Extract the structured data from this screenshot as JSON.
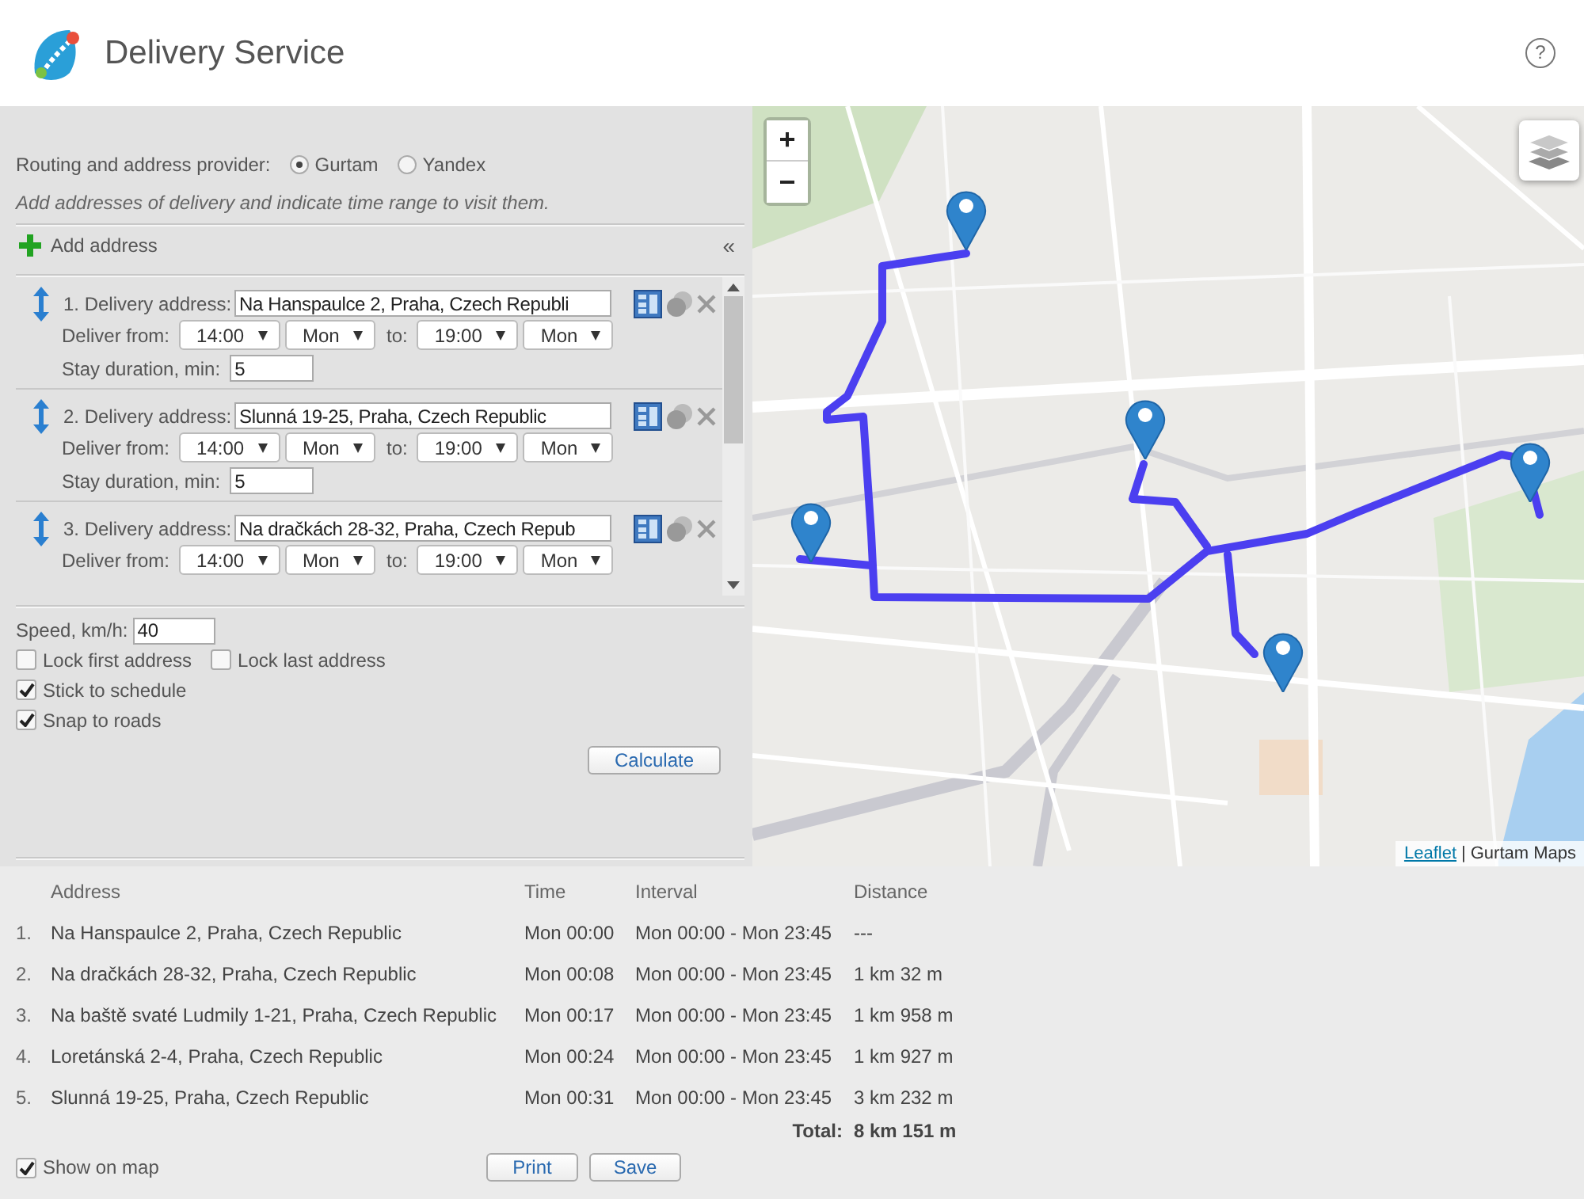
{
  "header": {
    "title": "Delivery Service",
    "help": "?"
  },
  "provider": {
    "label": "Routing and address provider:",
    "options": [
      {
        "label": "Gurtam",
        "selected": true
      },
      {
        "label": "Yandex",
        "selected": false
      }
    ]
  },
  "hint": "Add addresses of delivery and indicate time range to visit them.",
  "add_address": {
    "label": "Add address",
    "collapse": "«"
  },
  "addresses": [
    {
      "label": "1. Delivery address:",
      "address": "Na Hanspaulce 2, Praha, Czech Republi",
      "from_label": "Deliver from:",
      "from_time": "14:00",
      "from_day": "Mon",
      "to_label": "to:",
      "to_time": "19:00",
      "to_day": "Mon",
      "stay_label": "Stay duration, min:",
      "stay": "5"
    },
    {
      "label": "2. Delivery address:",
      "address": "Slunná 19-25, Praha, Czech Republic",
      "from_label": "Deliver from:",
      "from_time": "14:00",
      "from_day": "Mon",
      "to_label": "to:",
      "to_time": "19:00",
      "to_day": "Mon",
      "stay_label": "Stay duration, min:",
      "stay": "5"
    },
    {
      "label": "3. Delivery address:",
      "address": "Na dračkách 28-32, Praha, Czech Repub",
      "from_label": "Deliver from:",
      "from_time": "14:00",
      "from_day": "Mon",
      "to_label": "to:",
      "to_time": "19:00",
      "to_day": "Mon"
    }
  ],
  "speed": {
    "label": "Speed, km/h:",
    "value": "40"
  },
  "option_rows": [
    [
      {
        "label": "Lock first address",
        "checked": false
      },
      {
        "label": "Lock last address",
        "checked": false
      }
    ],
    [
      {
        "label": "Stick to schedule",
        "checked": true
      }
    ],
    [
      {
        "label": "Snap to roads",
        "checked": true
      }
    ]
  ],
  "calculate": "Calculate",
  "map": {
    "zoom_in": "+",
    "zoom_out": "−",
    "attribution_link": "Leaflet",
    "attribution_separator": "|",
    "attribution_text": "Gurtam Maps"
  },
  "results": {
    "columns": [
      "Address",
      "Time",
      "Interval",
      "Distance"
    ],
    "rows": [
      {
        "index": "1.",
        "address": "Na Hanspaulce 2, Praha, Czech Republic",
        "time": "Mon 00:00",
        "interval": "Mon 00:00 - Mon 23:45",
        "distance": "---"
      },
      {
        "index": "2.",
        "address": "Na dračkách 28-32, Praha, Czech Republic",
        "time": "Mon 00:08",
        "interval": "Mon 00:00 - Mon 23:45",
        "distance": "1 km 32 m"
      },
      {
        "index": "3.",
        "address": "Na baště svaté Ludmily 1-21, Praha, Czech Republic",
        "time": "Mon 00:17",
        "interval": "Mon 00:00 - Mon 23:45",
        "distance": "1 km 958 m"
      },
      {
        "index": "4.",
        "address": "Loretánská 2-4, Praha, Czech Republic",
        "time": "Mon 00:24",
        "interval": "Mon 00:00 - Mon 23:45",
        "distance": "1 km 927 m"
      },
      {
        "index": "5.",
        "address": "Slunná 19-25, Praha, Czech Republic",
        "time": "Mon 00:31",
        "interval": "Mon 00:00 - Mon 23:45",
        "distance": "3 km 232 m"
      }
    ],
    "total_label": "Total:",
    "total": "8 km 151 m"
  },
  "show_on_map": {
    "label": "Show on map",
    "checked": true
  },
  "buttons": [
    "Print",
    "Save"
  ]
}
